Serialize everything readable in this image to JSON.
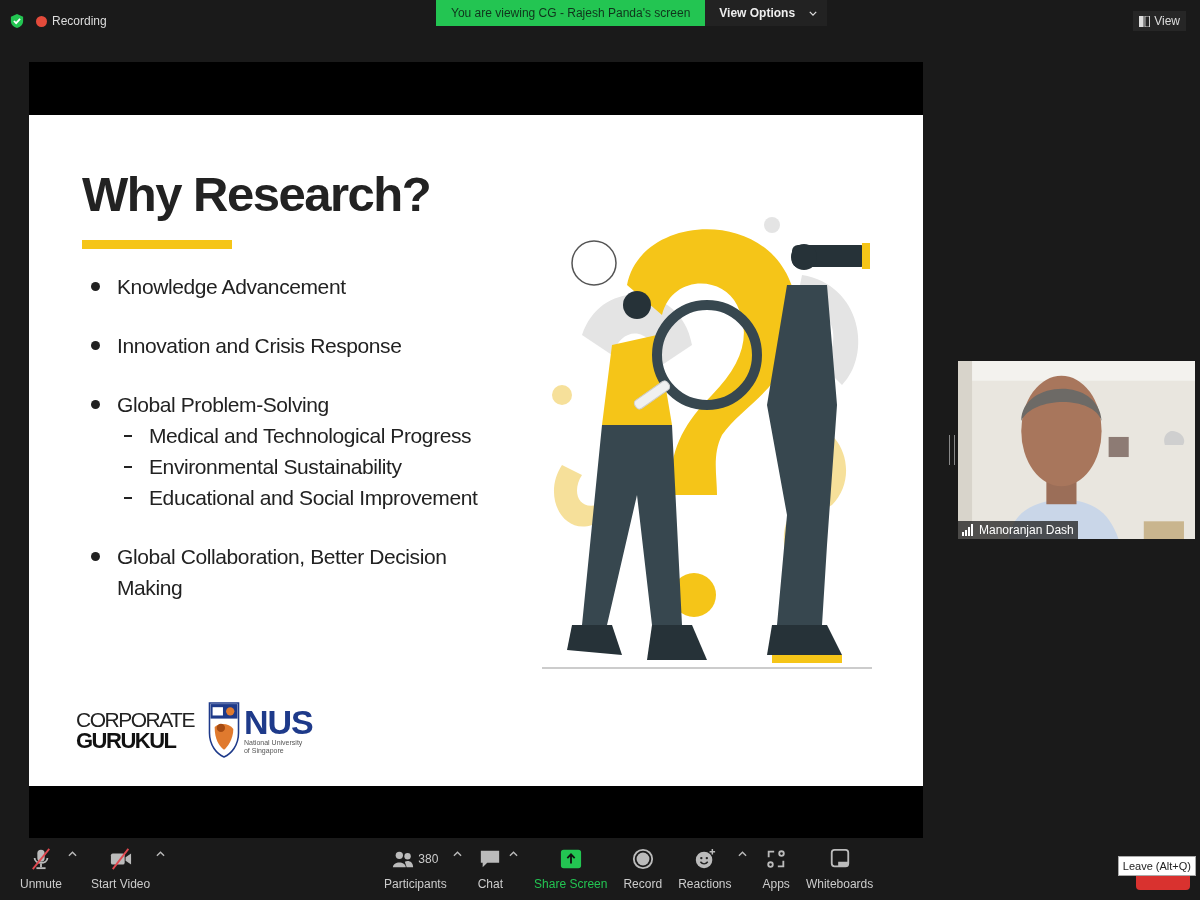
{
  "top_bar": {
    "recording_label": "Recording",
    "share_banner": "You are viewing CG - Rajesh Panda's screen",
    "view_options": "View Options",
    "view_button": "View"
  },
  "slide": {
    "title": "Why Research?",
    "bullets": [
      {
        "text": "Knowledge Advancement"
      },
      {
        "text": "Innovation and Crisis Response"
      },
      {
        "text": "Global Problem-Solving",
        "children": [
          {
            "text": "Medical and Technological Progress"
          },
          {
            "text": "Environmental Sustainability"
          },
          {
            "text": "Educational and Social Improvement"
          }
        ]
      },
      {
        "text": "Global Collaboration, Better Decision Making"
      }
    ],
    "logos": {
      "brand_top": "CORPORATE",
      "brand_bottom": "GURUKUL",
      "nus": "NUS",
      "nus_line_1": "National University",
      "nus_line_2": "of Singapore"
    }
  },
  "video_tile": {
    "name": "Manoranjan Dash",
    "kind": "picture"
  },
  "toolbar": [
    {
      "kind": "mic",
      "label": "Unmute",
      "muted": true,
      "menu": true
    },
    {
      "kind": "video",
      "label": "Start Video",
      "muted": true,
      "menu": true
    },
    {
      "kind": "participants",
      "label": "Participants",
      "count": "380",
      "menu": true
    },
    {
      "kind": "chat",
      "label": "Chat",
      "menu": true
    },
    {
      "kind": "share",
      "label": "Share Screen",
      "menu": false
    },
    {
      "kind": "record",
      "label": "Record",
      "menu": false
    },
    {
      "kind": "reactions",
      "label": "Reactions",
      "menu": true
    },
    {
      "kind": "apps",
      "label": "Apps",
      "menu": false
    },
    {
      "kind": "whiteboards",
      "label": "Whiteboards",
      "menu": false
    }
  ],
  "tooltip": "Leave (Alt+Q)"
}
